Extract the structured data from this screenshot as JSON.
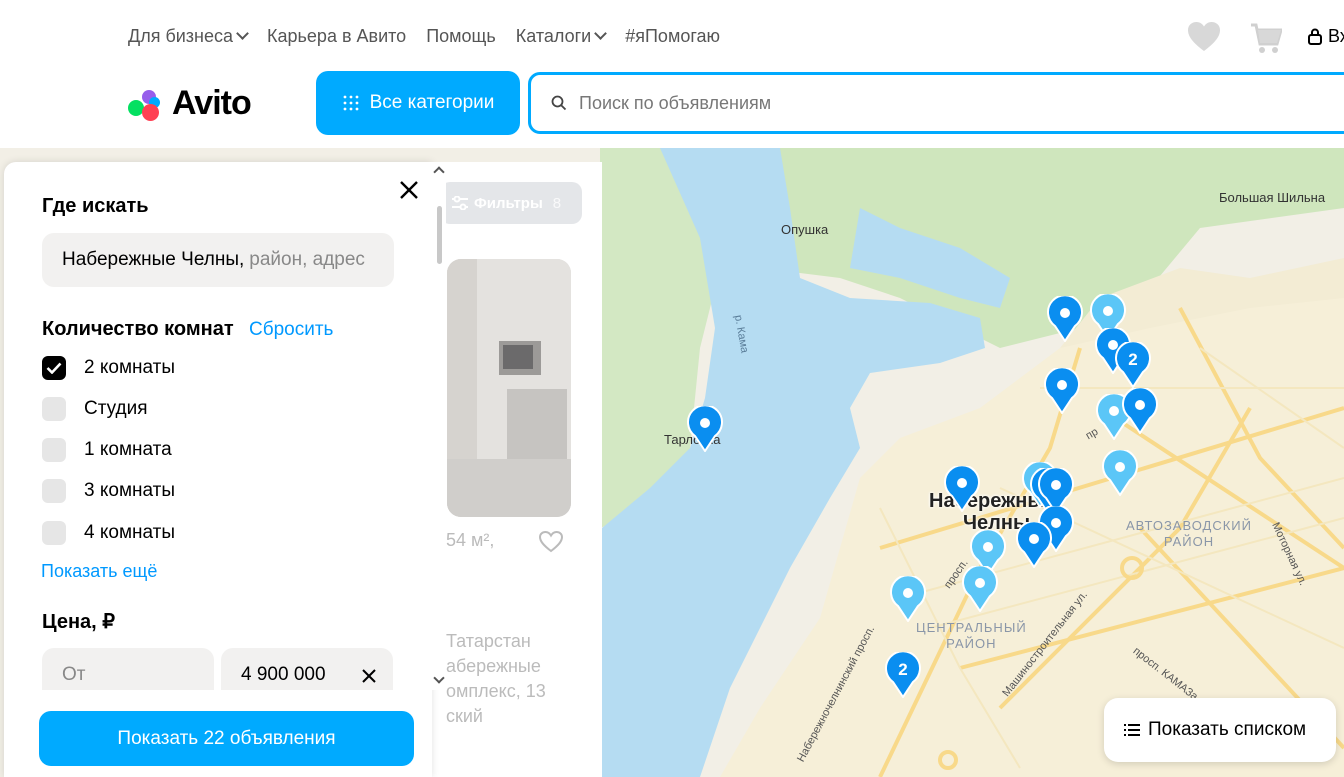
{
  "topnav": {
    "links": [
      "Для бизнеса",
      "Карьера в Авито",
      "Помощь",
      "Каталоги",
      "#яПомогаю"
    ],
    "login": "Вх"
  },
  "header": {
    "logo_text": "Avito",
    "categories_button": "Все категории",
    "search_placeholder": "Поиск по объявлениям"
  },
  "filters_panel": {
    "where_title": "Где искать",
    "location_value": "Набережные Челны,",
    "location_placeholder": "район, адрес",
    "rooms_title": "Количество комнат",
    "reset_label": "Сбросить",
    "rooms": [
      {
        "label": "2 комнаты",
        "checked": true
      },
      {
        "label": "Студия",
        "checked": false
      },
      {
        "label": "1 комната",
        "checked": false
      },
      {
        "label": "3 комнаты",
        "checked": false
      },
      {
        "label": "4 комнаты",
        "checked": false
      }
    ],
    "show_more": "Показать ещё",
    "price_title": "Цена, ₽",
    "price_from_placeholder": "От",
    "price_to_value": "4 900 000",
    "show_button": "Показать 22 объявления"
  },
  "listing": {
    "filters_button": "Фильтры",
    "filters_count": "8",
    "area_fragment": "54 м²,",
    "address_lines": [
      "Татарстан",
      "абережные",
      "омплекс, 13",
      "ский"
    ]
  },
  "map": {
    "labels": {
      "opushka": "Опушка",
      "bolshaya_shilna": "Большая Шильна",
      "tarlovka": "Тарловка",
      "river": "р. Кама",
      "city_line1": "Набережные",
      "city_line2": "Челны",
      "district_auto_1": "АВТОЗАВОДСКИЙ",
      "district_auto_2": "РАЙОН",
      "district_center_1": "ЦЕНТРАЛЬНЫЙ",
      "district_center_2": "РАЙОН",
      "street_motor": "Моторная ул.",
      "street_mashin": "Машиностроительная ул.",
      "street_kamaz": "просп. КАМАЗа",
      "street_chelny": "Набережночелнинский просп.",
      "street_prosp": "просп.",
      "street_pr": "пр"
    },
    "cluster_counts": [
      "2",
      "2"
    ],
    "list_view_button": "Показать списком"
  },
  "colors": {
    "accent": "#00aaff",
    "pin_dark": "#0a8ef0",
    "pin_light": "#5bc6f7",
    "water": "#b5dcf2",
    "forest": "#c9e3b6",
    "urban": "#f6eed6"
  }
}
